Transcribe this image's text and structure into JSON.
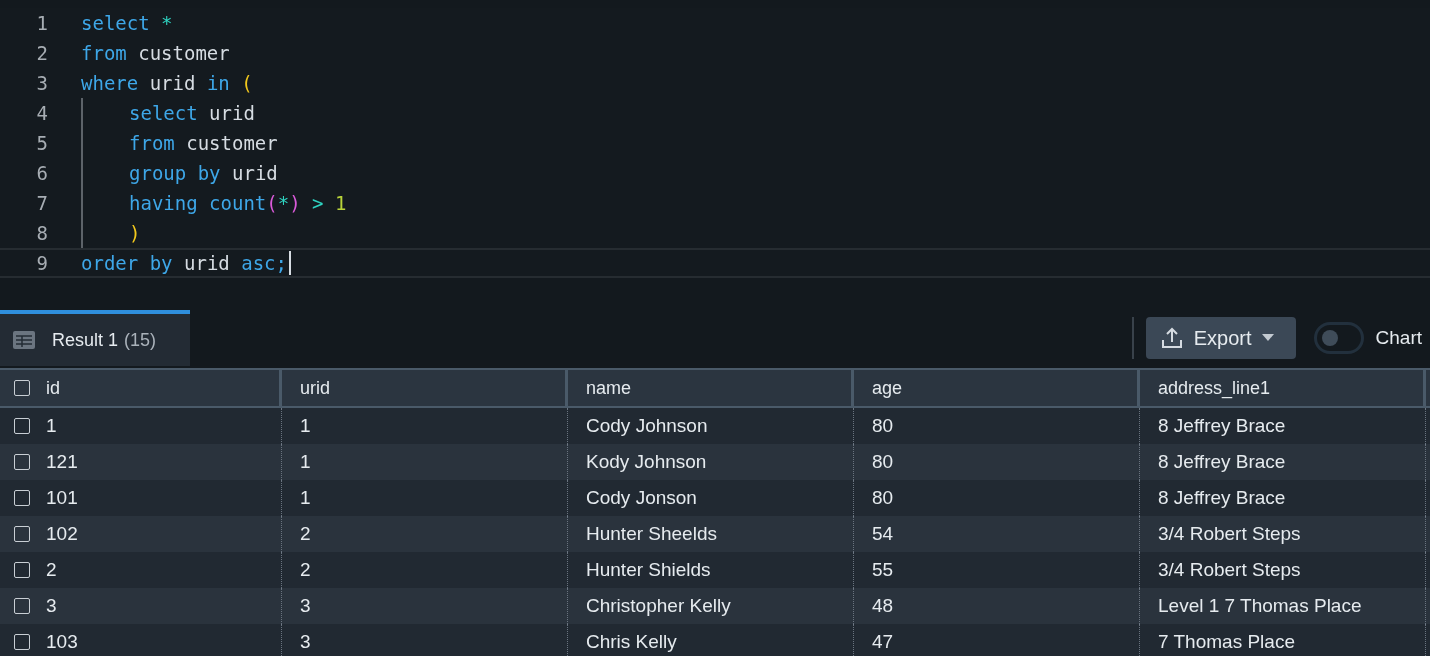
{
  "editor": {
    "lines": [
      {
        "number": "1",
        "current": false,
        "tokens": [
          {
            "kind": "keyword",
            "text": "select"
          },
          {
            "kind": "operator",
            "text": "*"
          }
        ]
      },
      {
        "number": "2",
        "current": false,
        "tokens": [
          {
            "kind": "keyword",
            "text": "from"
          },
          {
            "kind": "identifier",
            "text": "customer"
          }
        ]
      },
      {
        "number": "3",
        "current": false,
        "tokens": [
          {
            "kind": "keyword",
            "text": "where"
          },
          {
            "kind": "identifier",
            "text": "urid"
          },
          {
            "kind": "keyword",
            "text": "in"
          },
          {
            "kind": "paren",
            "text": "("
          }
        ],
        "children": [
          {
            "number": "4",
            "current": false,
            "tokens": [
              {
                "kind": "keyword",
                "text": "select"
              },
              {
                "kind": "identifier",
                "text": "urid"
              }
            ]
          },
          {
            "number": "5",
            "current": false,
            "tokens": [
              {
                "kind": "keyword",
                "text": "from"
              },
              {
                "kind": "identifier",
                "text": "customer"
              }
            ]
          },
          {
            "number": "6",
            "current": false,
            "tokens": [
              {
                "kind": "keyword",
                "text": "group"
              },
              {
                "kind": "keyword",
                "text": "by"
              },
              {
                "kind": "identifier",
                "text": "urid"
              }
            ]
          },
          {
            "number": "7",
            "current": false,
            "tokens": [
              {
                "kind": "keyword",
                "text": "having"
              },
              {
                "kind": "call",
                "text": "count(*)"
              },
              {
                "kind": "operator",
                "text": ">"
              },
              {
                "kind": "number",
                "text": "1"
              }
            ]
          },
          {
            "number": "8",
            "current": false,
            "tokens": [
              {
                "kind": "paren",
                "text": ")"
              }
            ]
          }
        ]
      },
      {
        "number": "9",
        "current": true,
        "tokens": [
          {
            "kind": "keyword",
            "text": "order"
          },
          {
            "kind": "keyword",
            "text": "by"
          },
          {
            "kind": "identifier",
            "text": "urid"
          },
          {
            "kind": "keyword",
            "text": "asc;"
          }
        ]
      }
    ]
  },
  "results": {
    "tabs": [
      {
        "label": "Result 1",
        "count": "(15)",
        "selected": true
      }
    ],
    "export_button": "Export",
    "chart_toggle": {
      "label": "Chart",
      "on": false
    },
    "table": {
      "select_all_checked": false,
      "columns": [
        "id",
        "urid",
        "name",
        "age",
        "address_line1"
      ],
      "rows": [
        {
          "checked": false,
          "cells": [
            "1",
            "1",
            "Cody Johnson",
            "80",
            "8 Jeffrey Brace"
          ]
        },
        {
          "checked": false,
          "cells": [
            "121",
            "1",
            "Kody Johnson",
            "80",
            "8 Jeffrey Brace"
          ]
        },
        {
          "checked": false,
          "cells": [
            "101",
            "1",
            "Cody Jonson",
            "80",
            "8 Jeffrey Brace"
          ]
        },
        {
          "checked": false,
          "cells": [
            "102",
            "2",
            "Hunter Sheelds",
            "54",
            "3/4 Robert Steps"
          ]
        },
        {
          "checked": false,
          "cells": [
            "2",
            "2",
            "Hunter Shields",
            "55",
            "3/4 Robert Steps"
          ]
        },
        {
          "checked": false,
          "cells": [
            "3",
            "3",
            "Christopher Kelly",
            "48",
            "Level 1 7 Thomas Place"
          ]
        },
        {
          "checked": false,
          "cells": [
            "103",
            "3",
            "Chris Kelly",
            "47",
            "7 Thomas Place"
          ]
        }
      ]
    }
  }
}
